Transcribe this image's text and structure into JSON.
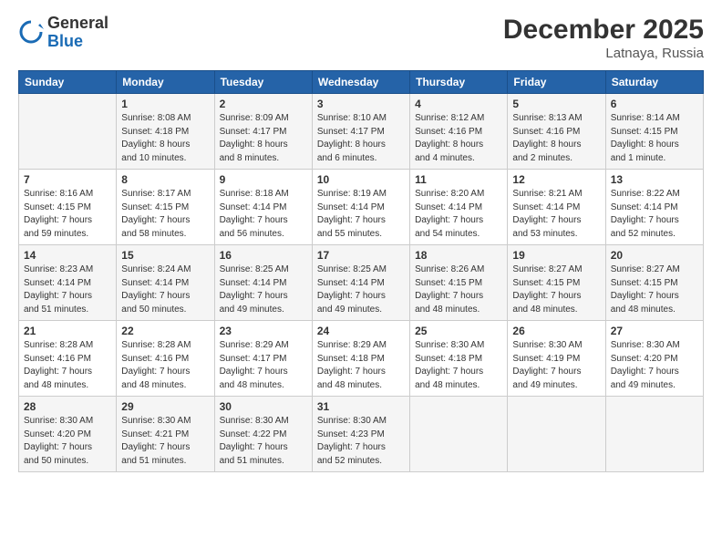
{
  "logo": {
    "general": "General",
    "blue": "Blue"
  },
  "title": "December 2025",
  "location": "Latnaya, Russia",
  "days_of_week": [
    "Sunday",
    "Monday",
    "Tuesday",
    "Wednesday",
    "Thursday",
    "Friday",
    "Saturday"
  ],
  "weeks": [
    [
      {
        "day": "",
        "info": ""
      },
      {
        "day": "1",
        "info": "Sunrise: 8:08 AM\nSunset: 4:18 PM\nDaylight: 8 hours\nand 10 minutes."
      },
      {
        "day": "2",
        "info": "Sunrise: 8:09 AM\nSunset: 4:17 PM\nDaylight: 8 hours\nand 8 minutes."
      },
      {
        "day": "3",
        "info": "Sunrise: 8:10 AM\nSunset: 4:17 PM\nDaylight: 8 hours\nand 6 minutes."
      },
      {
        "day": "4",
        "info": "Sunrise: 8:12 AM\nSunset: 4:16 PM\nDaylight: 8 hours\nand 4 minutes."
      },
      {
        "day": "5",
        "info": "Sunrise: 8:13 AM\nSunset: 4:16 PM\nDaylight: 8 hours\nand 2 minutes."
      },
      {
        "day": "6",
        "info": "Sunrise: 8:14 AM\nSunset: 4:15 PM\nDaylight: 8 hours\nand 1 minute."
      }
    ],
    [
      {
        "day": "7",
        "info": "Sunrise: 8:16 AM\nSunset: 4:15 PM\nDaylight: 7 hours\nand 59 minutes."
      },
      {
        "day": "8",
        "info": "Sunrise: 8:17 AM\nSunset: 4:15 PM\nDaylight: 7 hours\nand 58 minutes."
      },
      {
        "day": "9",
        "info": "Sunrise: 8:18 AM\nSunset: 4:14 PM\nDaylight: 7 hours\nand 56 minutes."
      },
      {
        "day": "10",
        "info": "Sunrise: 8:19 AM\nSunset: 4:14 PM\nDaylight: 7 hours\nand 55 minutes."
      },
      {
        "day": "11",
        "info": "Sunrise: 8:20 AM\nSunset: 4:14 PM\nDaylight: 7 hours\nand 54 minutes."
      },
      {
        "day": "12",
        "info": "Sunrise: 8:21 AM\nSunset: 4:14 PM\nDaylight: 7 hours\nand 53 minutes."
      },
      {
        "day": "13",
        "info": "Sunrise: 8:22 AM\nSunset: 4:14 PM\nDaylight: 7 hours\nand 52 minutes."
      }
    ],
    [
      {
        "day": "14",
        "info": "Sunrise: 8:23 AM\nSunset: 4:14 PM\nDaylight: 7 hours\nand 51 minutes."
      },
      {
        "day": "15",
        "info": "Sunrise: 8:24 AM\nSunset: 4:14 PM\nDaylight: 7 hours\nand 50 minutes."
      },
      {
        "day": "16",
        "info": "Sunrise: 8:25 AM\nSunset: 4:14 PM\nDaylight: 7 hours\nand 49 minutes."
      },
      {
        "day": "17",
        "info": "Sunrise: 8:25 AM\nSunset: 4:14 PM\nDaylight: 7 hours\nand 49 minutes."
      },
      {
        "day": "18",
        "info": "Sunrise: 8:26 AM\nSunset: 4:15 PM\nDaylight: 7 hours\nand 48 minutes."
      },
      {
        "day": "19",
        "info": "Sunrise: 8:27 AM\nSunset: 4:15 PM\nDaylight: 7 hours\nand 48 minutes."
      },
      {
        "day": "20",
        "info": "Sunrise: 8:27 AM\nSunset: 4:15 PM\nDaylight: 7 hours\nand 48 minutes."
      }
    ],
    [
      {
        "day": "21",
        "info": "Sunrise: 8:28 AM\nSunset: 4:16 PM\nDaylight: 7 hours\nand 48 minutes."
      },
      {
        "day": "22",
        "info": "Sunrise: 8:28 AM\nSunset: 4:16 PM\nDaylight: 7 hours\nand 48 minutes."
      },
      {
        "day": "23",
        "info": "Sunrise: 8:29 AM\nSunset: 4:17 PM\nDaylight: 7 hours\nand 48 minutes."
      },
      {
        "day": "24",
        "info": "Sunrise: 8:29 AM\nSunset: 4:18 PM\nDaylight: 7 hours\nand 48 minutes."
      },
      {
        "day": "25",
        "info": "Sunrise: 8:30 AM\nSunset: 4:18 PM\nDaylight: 7 hours\nand 48 minutes."
      },
      {
        "day": "26",
        "info": "Sunrise: 8:30 AM\nSunset: 4:19 PM\nDaylight: 7 hours\nand 49 minutes."
      },
      {
        "day": "27",
        "info": "Sunrise: 8:30 AM\nSunset: 4:20 PM\nDaylight: 7 hours\nand 49 minutes."
      }
    ],
    [
      {
        "day": "28",
        "info": "Sunrise: 8:30 AM\nSunset: 4:20 PM\nDaylight: 7 hours\nand 50 minutes."
      },
      {
        "day": "29",
        "info": "Sunrise: 8:30 AM\nSunset: 4:21 PM\nDaylight: 7 hours\nand 51 minutes."
      },
      {
        "day": "30",
        "info": "Sunrise: 8:30 AM\nSunset: 4:22 PM\nDaylight: 7 hours\nand 51 minutes."
      },
      {
        "day": "31",
        "info": "Sunrise: 8:30 AM\nSunset: 4:23 PM\nDaylight: 7 hours\nand 52 minutes."
      },
      {
        "day": "",
        "info": ""
      },
      {
        "day": "",
        "info": ""
      },
      {
        "day": "",
        "info": ""
      }
    ]
  ]
}
